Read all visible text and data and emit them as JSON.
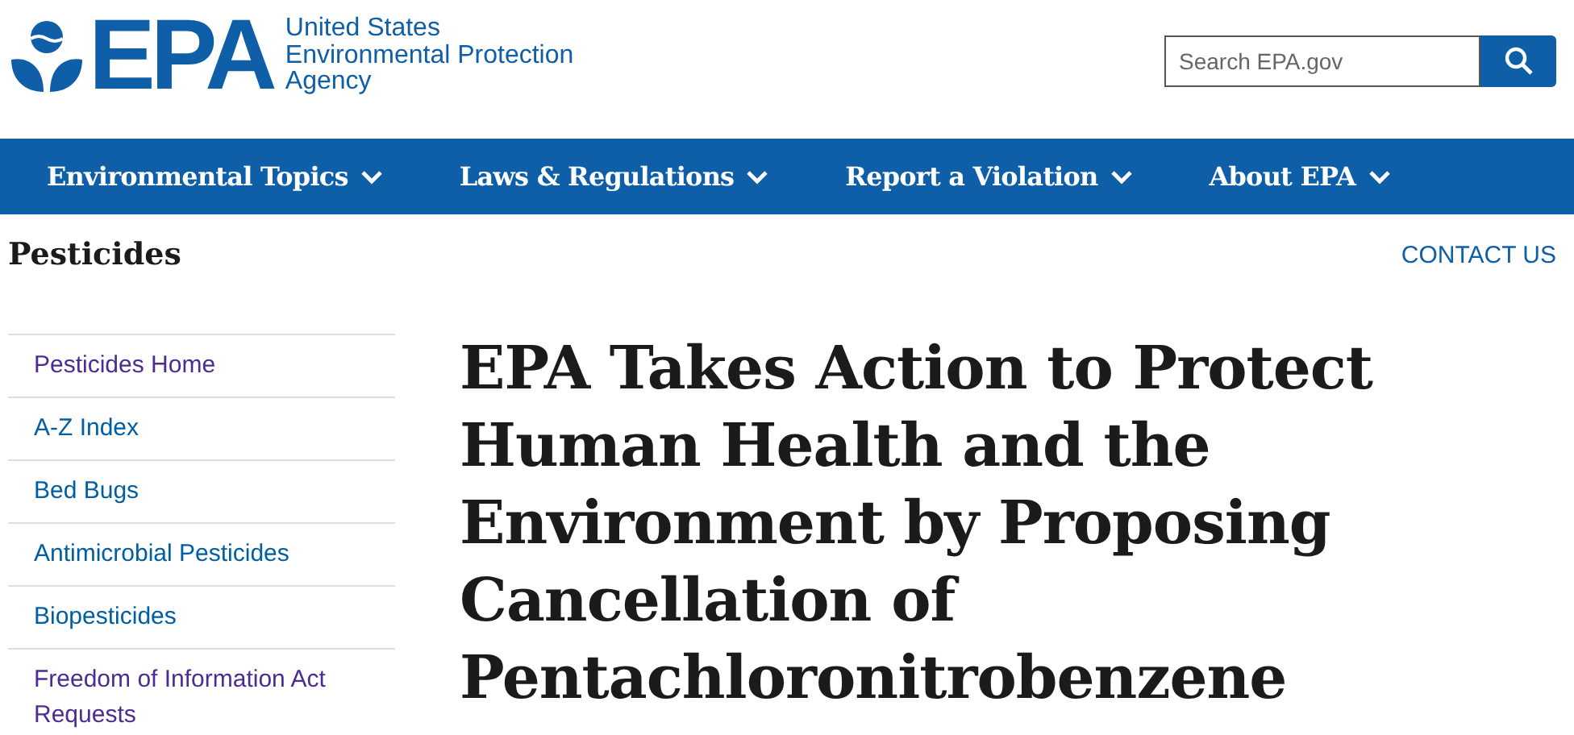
{
  "header": {
    "logo_text": "EPA",
    "agency_lines": [
      "United States",
      "Environmental Protection",
      "Agency"
    ],
    "search": {
      "placeholder": "Search EPA.gov"
    }
  },
  "nav": [
    {
      "label": "Environmental Topics",
      "expanded": false
    },
    {
      "label": "Laws & Regulations",
      "expanded": false
    },
    {
      "label": "Report a Violation",
      "expanded": false
    },
    {
      "label": "About EPA",
      "expanded": false
    }
  ],
  "section_title": "Pesticides",
  "contact_link": "CONTACT US",
  "sidebar": {
    "items": [
      {
        "label": "Pesticides Home",
        "visited": true
      },
      {
        "label": "A-Z Index",
        "visited": false
      },
      {
        "label": "Bed Bugs",
        "visited": false
      },
      {
        "label": "Antimicrobial Pesticides",
        "visited": false
      },
      {
        "label": "Biopesticides",
        "visited": false
      },
      {
        "label": "Freedom of Information Act Requests",
        "visited": true
      }
    ]
  },
  "article": {
    "title": "EPA Takes Action to Protect Human Health and the Environment by Proposing Cancellation of Pentachloronitrobenzene"
  }
}
